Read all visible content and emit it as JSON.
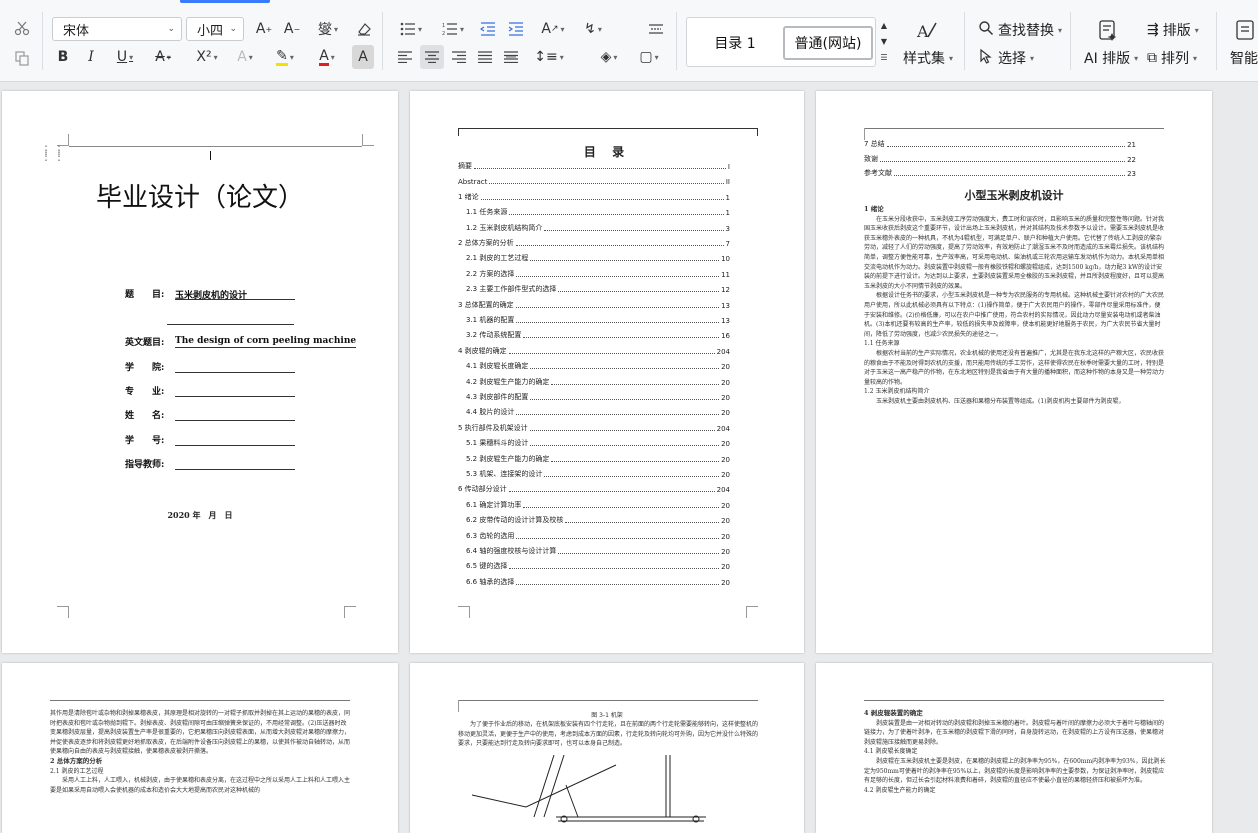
{
  "toolbar": {
    "font_name": "宋体",
    "font_size": "小四",
    "style_toc": "目录 1",
    "style_normal": "普通(网站)",
    "styles_label": "样式集",
    "find_replace_label": "查找替换",
    "select_label": "选择",
    "ai_layout_label": "AI 排版",
    "layout_label": "排版",
    "arrange_label": "排列",
    "smart_label": "智能"
  },
  "cover": {
    "title": "毕业设计（论文）",
    "fields": [
      {
        "label": "题　　目:",
        "value": "玉米剥皮机的设计"
      },
      {
        "label": "",
        "value": ""
      },
      {
        "label": "英文题目:",
        "value": "The design of corn peeling machine"
      },
      {
        "label": "学　　院:",
        "value": ""
      },
      {
        "label": "专　　业:",
        "value": ""
      },
      {
        "label": "姓　　名:",
        "value": ""
      },
      {
        "label": "学　　号:",
        "value": ""
      },
      {
        "label": "指导教师:",
        "value": ""
      }
    ],
    "date": "2020 年　月　日"
  },
  "toc": {
    "title": "目 录",
    "items": [
      {
        "t": "摘要",
        "p": "I"
      },
      {
        "t": "Abstract",
        "p": "II"
      },
      {
        "t": "1 绪论",
        "p": "1"
      },
      {
        "t": "  1.1 任务来源",
        "p": "1"
      },
      {
        "t": "  1.2 玉米剥皮机结构简介",
        "p": "3"
      },
      {
        "t": "2 总体方案的分析",
        "p": "7"
      },
      {
        "t": "  2.1 剥皮的工艺过程",
        "p": "10"
      },
      {
        "t": "  2.2 方案的选择",
        "p": "11"
      },
      {
        "t": "  2.3 主要工作部件型式的选择",
        "p": "12"
      },
      {
        "t": "3 总体配置的确定",
        "p": "13"
      },
      {
        "t": "  3.1 机器的配置",
        "p": "13"
      },
      {
        "t": "  3.2 传动系统配置",
        "p": "16"
      },
      {
        "t": "4 剥皮辊的确定",
        "p": "204"
      },
      {
        "t": "  4.1 剥皮辊长度确定",
        "p": "20"
      },
      {
        "t": "  4.2 剥皮辊生产能力的确定",
        "p": "20"
      },
      {
        "t": "  4.3 剥皮部件的配置",
        "p": "20"
      },
      {
        "t": "  4.4 胶片的设计",
        "p": "20"
      },
      {
        "t": "5 执行部件及机架设计",
        "p": "204"
      },
      {
        "t": "  5.1 果穗料斗的设计",
        "p": "20"
      },
      {
        "t": "  5.2 剥皮辊生产能力的确定",
        "p": "20"
      },
      {
        "t": "  5.3 机架、连接架的设计",
        "p": "20"
      },
      {
        "t": "6 传动部分设计",
        "p": "204"
      },
      {
        "t": "  6.1 确定计算功率",
        "p": "20"
      },
      {
        "t": "  6.2 皮带传动的设计计算及校核",
        "p": "20"
      },
      {
        "t": "  6.3 齿轮的选用",
        "p": "20"
      },
      {
        "t": "  6.4 轴的强度校核与设计计算",
        "p": "20"
      },
      {
        "t": "  6.5 键的选择",
        "p": "20"
      },
      {
        "t": "  6.6 轴承的选择",
        "p": "20"
      }
    ]
  },
  "page3": {
    "toc_tail": [
      {
        "t": "7 总结",
        "p": "21"
      },
      {
        "t": "致谢",
        "p": "22"
      },
      {
        "t": "参考文献",
        "p": "23"
      }
    ],
    "heading": "小型玉米剥皮机设计",
    "sec1": "1 绪论",
    "sec11": "1.1 任务来源",
    "sec12": "1.2 玉米剥皮机结构简介",
    "body1": "在玉米分段收获中，玉米剥皮工序劳动强度大，费工时和误农时，且影响玉米的质量和完整性等问题。针对我国玉米收获后剥皮这个重要环节，设计出场上玉米剥皮机，并对其结构及技术参数予以设计。需要玉米剥皮机是收获玉米穗外表皮的一种机具，不机为4辊机型，可满足单户、联户和种植大户使用。它代替了传统人工剥皮的繁杂劳动，减轻了人们的劳动强度，提高了劳动效率，有效地防止了潮湿玉米不及时而造成的玉米霉烂损失。该机结构简单，调整方便性能可靠，生产效率高，可采用电动机、柴油机或三轮农用运输车发动机作为动力。本机采用单相交流电动机作为动力。剥皮装置中剥皮辊一般有橡胶铁辊和螺旋辊组成，达到1500 kg/h，动力配3 kW的设计安装的前提下进行设计。为达到以上要求，主要剥皮装置采用全橡胶的玉米剥皮辊，并且所剥皮程度好，且可以提高玉米剥皮的大小不同情节剥皮的效果。",
    "body2": "根据设计任务书的要求，小型玉米剥皮机是一种专为农民服务的专用机械。这种机械主要针对农村的广大农民用户使用，所以此机械必须具有以下特点：(1)操作简单，便于广大农民用户的操作，零部件尽量采用标准件，便于安装和维修。(2)价格低廉，可以在农户中推广使用，符合农村的实际情况，因此动力尽量安装电动机或者柴油机。(3)本机还要有较高的生产率，较低的损失率及故障率，使本机能更好地服务于农民，为广大农民节省大量时间，降低了劳动强度，也减少农民损失的途径之一。",
    "body3": "根据农村当前的生产实际情况，农业机械的使用还没有普遍推广，尤其是在我东北这样的产粮大区，农民收获的粮食由于不能及时得到农机的支援，而只能用传统的手工劳作，这样使得农民在秋季时需要大量的工时，特别是对于玉米这一高产稳产的作物，在东北地区特别是我省由于有大量的播种面积，而这种作物的本身又是一种劳动力量较高的作物。",
    "body4": "玉米剥皮机主要由剥皮机构、压送器和果穗分布装置等组成。(1)剥皮机构主要部件为剥皮辊，"
  },
  "page4": {
    "body_a": "其作用是清除苞叶或杂物和剥掉果穗表皮，其原理是相对旋转的一对辊子抓取并剥掉在其上运动的果穗的表皮，同时把表皮和苞叶或杂物抛到辊下。剥掉表皮、剥皮辊间隙可由压缩弹簧来保证的，不用经常调整。(2)压送器时改变果穗剥皮层量，提高剥皮装置生产率是很重要的，它把果穗压向剥皮辊表面，从而增大剥皮辊对果穗的摩擦力，并促使表皮逐步和将剥皮辊更好地抓取表皮，在后端附件设备压向剥皮辊上的果穗，以使其作被动自轴转动，从而使果穗向自由的表皮与剥皮辊接触，使果穗表皮被剥开撕落。",
    "sec2": "2 总体方案的分析",
    "sec21": "2.1 剥皮的工艺过程",
    "body_b": "采用人工上料，人工喂入，机械剥皮，由于使果穗和表皮分离，在这过程中之所以采用人工上料和人工喂入主要是如果采用自动喂入会使机器的成本和造价会大大地提高而农民对这种机械的"
  },
  "page5": {
    "fig_caption": "图 3-1 机架",
    "body": "为了便于作业后的移动，在机架底板安装有四个行走轮，且在前面的两个行走轮需要能够转向，这样使整机的移动更加灵活，更便于生产中的使用，考虑到成本方面的因素，行走轮及转向轮均可外购，因为它并没什么特殊的要求，只要能达到行走及转向要求即可，也可以本身自己制造。"
  },
  "page6": {
    "sec4": "4 剥皮辊装置的确定",
    "body": "剥皮装置是由一对相对转动的剥皮辊和剥掉玉米穗的着叶。剥皮辊与着叶间的摩擦力必须大于着叶与穗轴间的链接力，为了使着叶剥净，在玉米穗的剥皮辊下滑的同时，自身旋转运动，在剥皮辊的上方设有压送器，使果穗对剥皮辊施压接触而更易剥除。",
    "sec41": "4.1 剥皮辊长度确定",
    "body2": "剥皮辊在玉米剥皮机主要是剥皮，在果穗的剥皮辊上的剥净率为95%，在600mm内剥净率为93%，因此剥长定为950mm可使着叶的剥净率在95%以上，剥皮辊的长度是影响剥净率的主要参数，为保证剥净率时，剥皮辊应有足够的长度，但过长会引起材料浪费和着碎，剥皮辊的直径应不使最小直径的果穗轻挤压和被损坏为准。",
    "sec42": "4.2 剥皮辊生产能力的确定"
  }
}
